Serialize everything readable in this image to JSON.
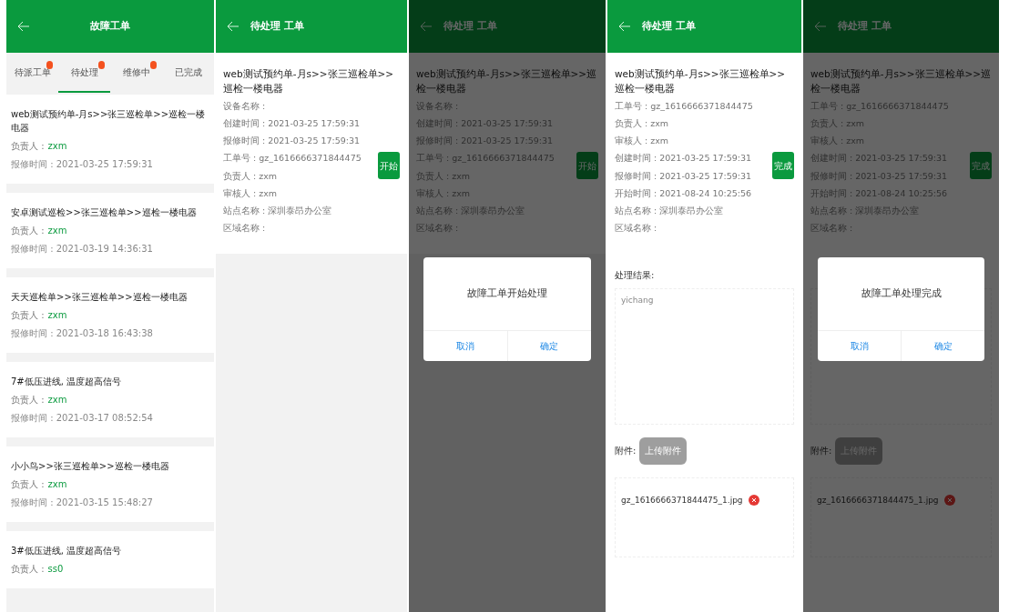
{
  "screens": [
    {
      "kind": "list",
      "title": "故障工单",
      "tabs": [
        {
          "label": "待派工单",
          "dot": true,
          "selected": false
        },
        {
          "label": "待处理",
          "dot": true,
          "selected": true
        },
        {
          "label": "维修中",
          "dot": true,
          "selected": false
        },
        {
          "label": "已完成",
          "dot": false,
          "selected": false
        }
      ],
      "items": [
        {
          "title": "web测试预约单-月s>>张三巡检单>>巡检一楼电器",
          "owner_label": "负责人 :",
          "owner": "zxm",
          "time": "报修时间 : 2021-03-25 17:59:31"
        },
        {
          "title": "安卓测试巡检>>张三巡检单>>巡检一楼电器",
          "owner_label": "负责人 :",
          "owner": "zxm",
          "time": "报修时间 : 2021-03-19 14:36:31"
        },
        {
          "title": "天天巡检单>>张三巡检单>>巡检一楼电器",
          "owner_label": "负责人 :",
          "owner": "zxm",
          "time": "报修时间 : 2021-03-18 16:43:38"
        },
        {
          "title": "7#低压进线, 温度超高信号",
          "owner_label": "负责人 :",
          "owner": "zxm",
          "time": "报修时间 : 2021-03-17 08:52:54"
        },
        {
          "title": "小小鸟>>张三巡检单>>巡检一楼电器",
          "owner_label": "负责人 :",
          "owner": "zxm",
          "time": "报修时间 : 2021-03-15 15:48:27"
        },
        {
          "title": "3#低压进线, 温度超高信号",
          "owner_label": "负责人 :",
          "owner": "ss0"
        }
      ]
    },
    {
      "kind": "detail",
      "title": "待处理 工单",
      "dimmed": false,
      "order_title": "web测试预约单-月s>>张三巡检单>>巡检一楼电器",
      "fields": [
        "设备名称 :",
        "创建时间 : 2021-03-25 17:59:31",
        "报修时间 : 2021-03-25 17:59:31",
        "工单号 : gz_1616666371844475",
        "负责人 : zxm",
        "审核人 : zxm",
        "站点名称 : 深圳泰昂办公室",
        "区域名称 :"
      ],
      "action": "开始"
    },
    {
      "kind": "detail",
      "title": "待处理 工单",
      "dimmed": true,
      "order_title": "web测试预约单-月s>>张三巡检单>>巡检一楼电器",
      "fields": [
        "设备名称 :",
        "创建时间 : 2021-03-25 17:59:31",
        "报修时间 : 2021-03-25 17:59:31",
        "工单号 : gz_1616666371844475",
        "负责人 : zxm",
        "审核人 : zxm",
        "站点名称 : 深圳泰昂办公室",
        "区域名称 :"
      ],
      "action": "开始",
      "dialog": {
        "message": "故障工单开始处理",
        "cancel": "取消",
        "confirm": "确定"
      }
    },
    {
      "kind": "detail",
      "title": "待处理 工单",
      "dimmed": false,
      "order_title": "web测试预约单-月s>>张三巡检单>>巡检一楼电器",
      "fields": [
        "工单号 : gz_1616666371844475",
        "负责人 : zxm",
        "审核人 : zxm",
        "创建时间 : 2021-03-25 17:59:31",
        "报修时间 : 2021-03-25 17:59:31",
        "开始时间 : 2021-08-24 10:25:56",
        "站点名称 : 深圳泰昂办公室",
        "区域名称 :"
      ],
      "action": "完成",
      "result": {
        "label": "处理结果:",
        "value": "yichang"
      },
      "attachment_label": "附件:",
      "upload": "上传附件",
      "file": "gz_1616666371844475_1.jpg"
    },
    {
      "kind": "detail",
      "title": "待处理 工单",
      "dimmed": true,
      "order_title": "web测试预约单-月s>>张三巡检单>>巡检一楼电器",
      "fields": [
        "工单号 : gz_1616666371844475",
        "负责人 : zxm",
        "审核人 : zxm",
        "创建时间 : 2021-03-25 17:59:31",
        "报修时间 : 2021-03-25 17:59:31",
        "开始时间 : 2021-08-24 10:25:56",
        "站点名称 : 深圳泰昂办公室",
        "区域名称 :"
      ],
      "action": "完成",
      "attachment_label": "附件:",
      "upload": "上传附件",
      "file": "gz_1616666371844475_1.jpg",
      "dialog": {
        "message": "故障工单处理完成",
        "cancel": "取消",
        "confirm": "确定"
      }
    }
  ]
}
